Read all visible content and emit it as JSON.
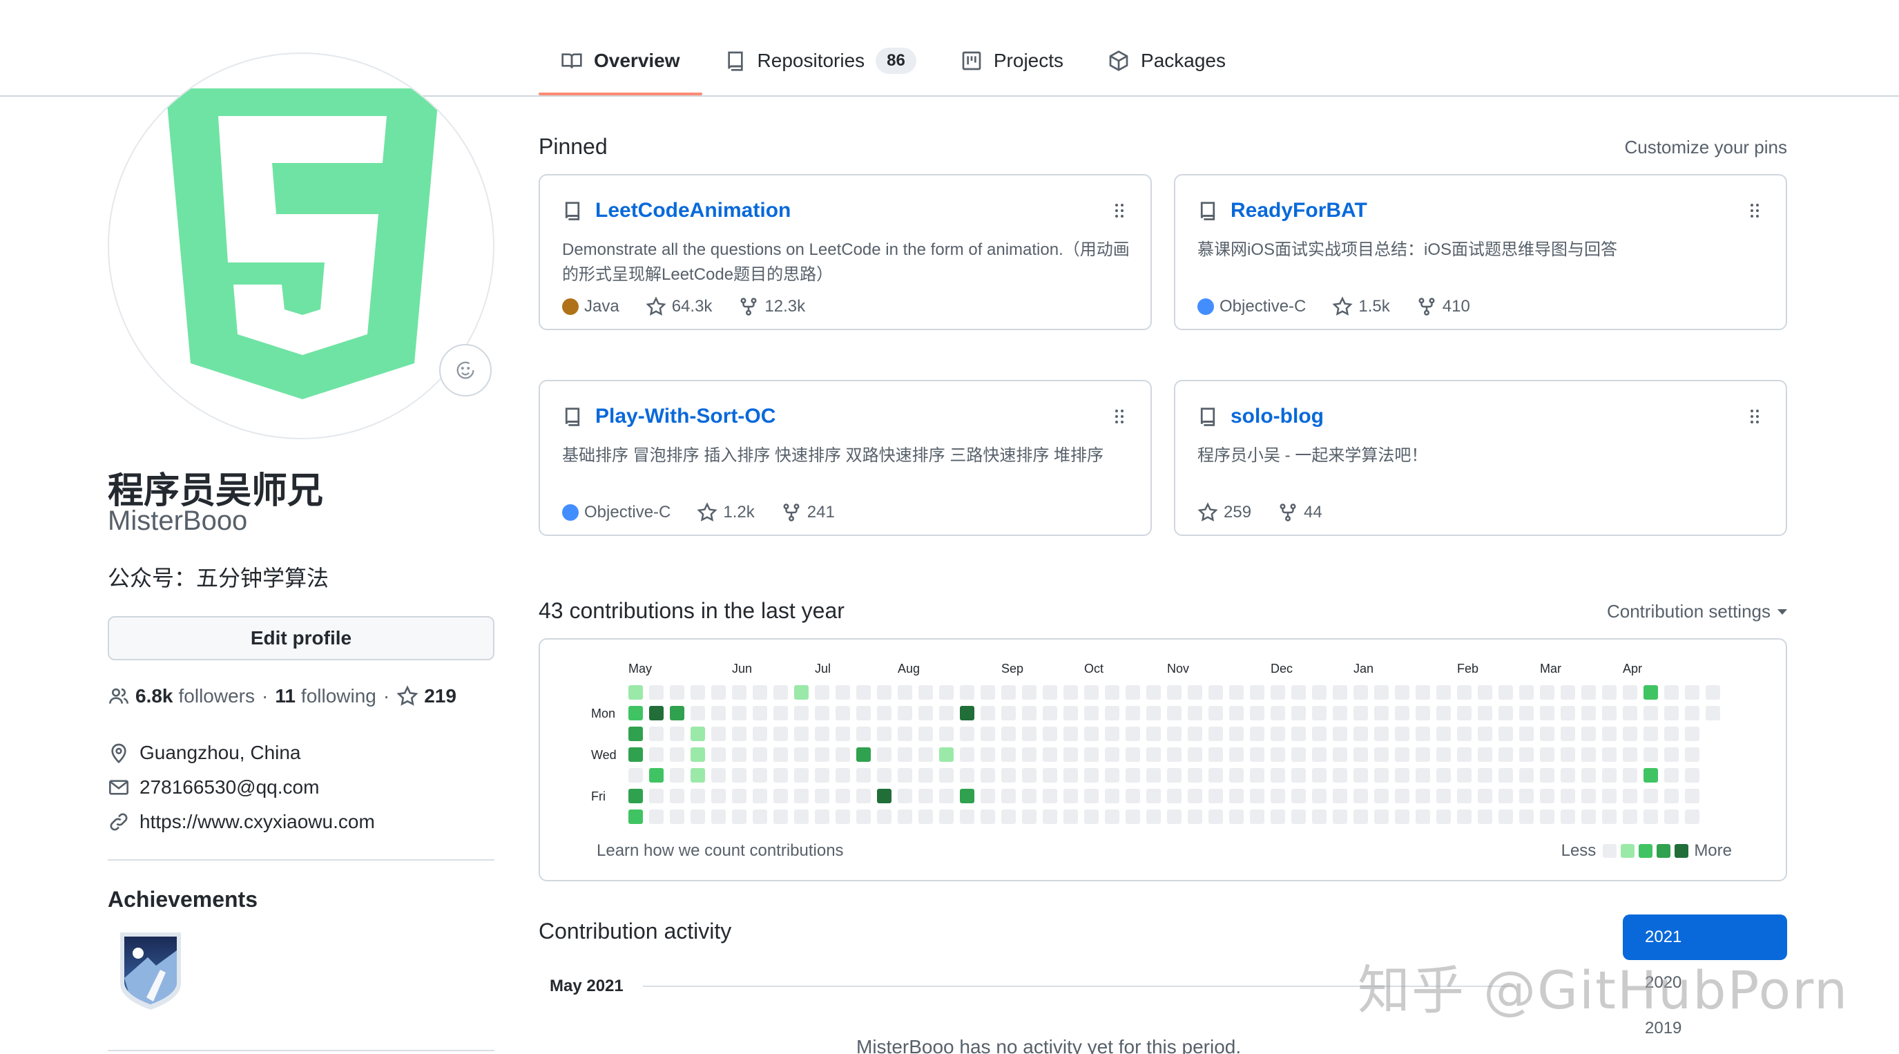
{
  "tabs": [
    {
      "label": "Overview",
      "icon": "book-icon",
      "selected": true
    },
    {
      "label": "Repositories",
      "icon": "repo-icon",
      "count": "86"
    },
    {
      "label": "Projects",
      "icon": "project-icon"
    },
    {
      "label": "Packages",
      "icon": "package-icon"
    }
  ],
  "profile": {
    "name": "程序员吴师兄",
    "login": "MisterBooo",
    "bio": "公众号：五分钟学算法",
    "edit_label": "Edit profile",
    "followers_count": "6.8k",
    "followers_label": "followers",
    "following_count": "11",
    "following_label": "following",
    "stars_count": "219",
    "location": "Guangzhou, China",
    "email": "278166530@qq.com",
    "website": "https://www.cxyxiaowu.com",
    "avatar_color": "#6fe3a3"
  },
  "achievements": {
    "title": "Achievements"
  },
  "pinned": {
    "title": "Pinned",
    "customize": "Customize your pins",
    "repos": [
      {
        "name": "LeetCodeAnimation",
        "description": "Demonstrate all the questions on LeetCode in the form of animation.（用动画的形式呈现解LeetCode题目的思路）",
        "language": "Java",
        "lang_color": "#b07219",
        "stars": "64.3k",
        "forks": "12.3k"
      },
      {
        "name": "ReadyForBAT",
        "description": "慕课网iOS面试实战项目总结：iOS面试题思维导图与回答",
        "language": "Objective-C",
        "lang_color": "#438eff",
        "stars": "1.5k",
        "forks": "410"
      },
      {
        "name": "Play-With-Sort-OC",
        "description": "基础排序 冒泡排序 插入排序 快速排序 双路快速排序 三路快速排序 堆排序",
        "language": "Objective-C",
        "lang_color": "#438eff",
        "stars": "1.2k",
        "forks": "241"
      },
      {
        "name": "solo-blog",
        "description": "程序员小吴 - 一起来学算法吧！",
        "language": "",
        "lang_color": "",
        "stars": "259",
        "forks": "44"
      }
    ]
  },
  "contributions": {
    "title": "43 contributions in the last year",
    "settings_label": "Contribution settings",
    "months": [
      "May",
      "Jun",
      "Jul",
      "Aug",
      "Sep",
      "Oct",
      "Nov",
      "Dec",
      "Jan",
      "Feb",
      "Mar",
      "Apr"
    ],
    "days": [
      "Mon",
      "Wed",
      "Fri"
    ],
    "learn_label": "Learn how we count contributions",
    "less_label": "Less",
    "more_label": "More",
    "level_colors": [
      "#ebedf0",
      "#9be9a8",
      "#40c463",
      "#30a14e",
      "#216e39"
    ]
  },
  "activity": {
    "title": "Contribution activity",
    "years": [
      "2021",
      "2020",
      "2019"
    ],
    "month": "May 2021",
    "empty_message": "MisterBooo has no activity yet for this period."
  },
  "watermark": "知乎 @GitHubPorn"
}
